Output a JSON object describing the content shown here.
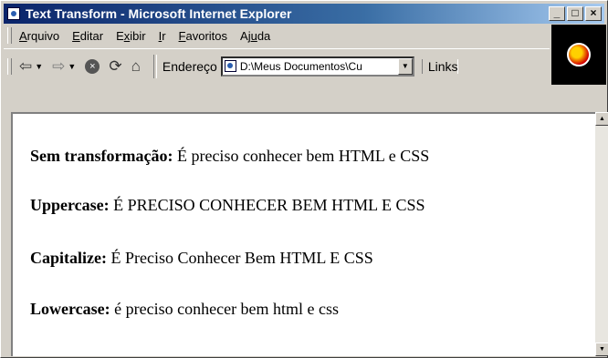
{
  "window": {
    "title": "Text Transform - Microsoft Internet Explorer"
  },
  "titlebar_buttons": {
    "minimize": "_",
    "maximize": "□",
    "close": "×"
  },
  "menu": [
    {
      "key": "A",
      "rest": "rquivo"
    },
    {
      "key": "E",
      "rest": "ditar"
    },
    {
      "pre": "E",
      "key": "x",
      "rest": "ibir"
    },
    {
      "key": "I",
      "rest": "r"
    },
    {
      "key": "F",
      "rest": "avoritos"
    },
    {
      "pre": "Aj",
      "key": "u",
      "rest": "da"
    }
  ],
  "toolbar": {
    "back_icon": "⇦",
    "forward_icon": "⇨",
    "stop_icon": "×",
    "refresh_icon": "⟳",
    "home_icon": "⌂",
    "address_label": "Endereço",
    "address_value": "D:\\Meus Documentos\\Cu",
    "links_label": "Links"
  },
  "content": {
    "lines": [
      {
        "label": "Sem transformação:",
        "text": "É preciso conhecer bem HTML e CSS"
      },
      {
        "label": "Uppercase:",
        "text": "É PRECISO CONHECER BEM HTML E CSS"
      },
      {
        "label": "Capitalize:",
        "text": "É Preciso Conhecer Bem HTML E CSS"
      },
      {
        "label": "Lowercase:",
        "text": "é preciso conhecer bem html e css"
      }
    ]
  },
  "colors": {
    "titlebar_start": "#0a246a",
    "titlebar_end": "#a6caf0",
    "chrome": "#d4d0c8"
  }
}
